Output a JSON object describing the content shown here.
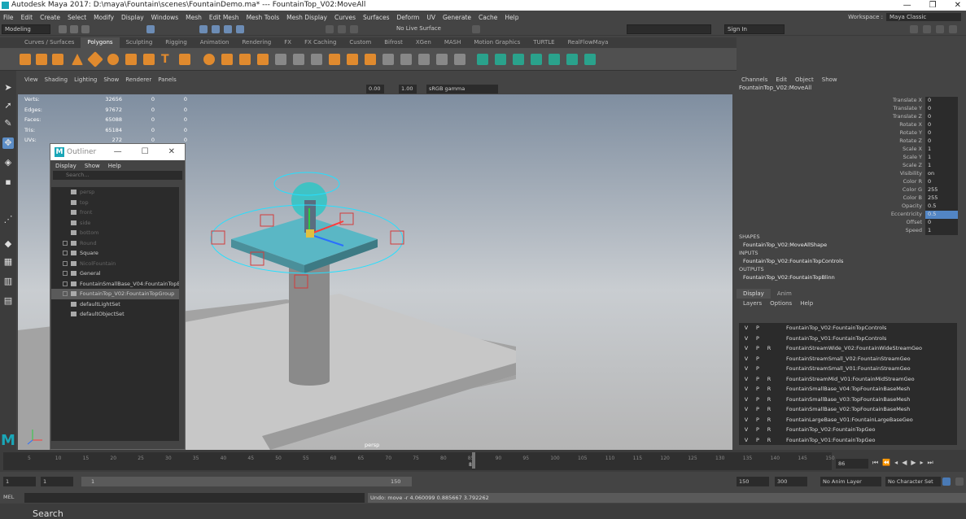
{
  "window": {
    "title": "Autodesk Maya 2017: D:\\maya\\Fountain\\scenes\\FountainDemo.ma*   ---   FountainTop_V02:MoveAll",
    "minimize": "—",
    "maximize": "❐",
    "close": "✕"
  },
  "menubar": [
    "File",
    "Edit",
    "Create",
    "Select",
    "Modify",
    "Display",
    "Windows",
    "Mesh",
    "Edit Mesh",
    "Mesh Tools",
    "Mesh Display",
    "Curves",
    "Surfaces",
    "Deform",
    "UV",
    "Generate",
    "Cache",
    "Help"
  ],
  "workspace": {
    "label": "Workspace :",
    "value": "Maya Classic"
  },
  "statusline": {
    "mode": "Modeling",
    "live_surface": "No Live Surface",
    "sign_in": "Sign In"
  },
  "shelf_tabs": [
    "Curves / Surfaces",
    "Polygons",
    "Sculpting",
    "Rigging",
    "Animation",
    "Rendering",
    "FX",
    "FX Caching",
    "Custom",
    "Bifrost",
    "XGen",
    "MASH",
    "Motion Graphics",
    "TURTLE",
    "RealFlowMaya"
  ],
  "shelf_active": "Polygons",
  "viewport": {
    "menu": [
      "View",
      "Shading",
      "Lighting",
      "Show",
      "Renderer",
      "Panels"
    ],
    "exposure": "0.00",
    "gamma": "1.00",
    "colorspace": "sRGB gamma",
    "camera_label": "persp",
    "hud": [
      {
        "label": "Verts:",
        "a": "32656",
        "b": "0",
        "c": "0"
      },
      {
        "label": "Edges:",
        "a": "97672",
        "b": "0",
        "c": "0"
      },
      {
        "label": "Faces:",
        "a": "65088",
        "b": "0",
        "c": "0"
      },
      {
        "label": "Tris:",
        "a": "65184",
        "b": "0",
        "c": "0"
      },
      {
        "label": "UVs:",
        "a": "272",
        "b": "0",
        "c": "0"
      }
    ]
  },
  "outliner": {
    "title": "Outliner",
    "menu": [
      "Display",
      "Show",
      "Help"
    ],
    "search_placeholder": "Search...",
    "items": [
      {
        "label": "persp",
        "dim": true,
        "exp": false
      },
      {
        "label": "top",
        "dim": true,
        "exp": false
      },
      {
        "label": "front",
        "dim": true,
        "exp": false
      },
      {
        "label": "side",
        "dim": true,
        "exp": false
      },
      {
        "label": "bottom",
        "dim": true,
        "exp": false
      },
      {
        "label": "Round",
        "dim": true,
        "exp": true
      },
      {
        "label": "Square",
        "dim": false,
        "exp": true
      },
      {
        "label": "NicolFountain",
        "dim": true,
        "exp": true
      },
      {
        "label": "General",
        "dim": false,
        "exp": true
      },
      {
        "label": "FountainSmallBase_V04:FountainTopB",
        "dim": false,
        "exp": true
      },
      {
        "label": "FountainTop_V02:FountainTopGroup",
        "dim": false,
        "exp": true,
        "selected": true
      },
      {
        "label": "defaultLightSet",
        "dim": false,
        "exp": false
      },
      {
        "label": "defaultObjectSet",
        "dim": false,
        "exp": false
      }
    ]
  },
  "channelbox": {
    "menu": [
      "Channels",
      "Edit",
      "Object",
      "Show"
    ],
    "object": "FountainTop_V02:MoveAll",
    "attributes": [
      {
        "name": "Translate X",
        "value": "0"
      },
      {
        "name": "Translate Y",
        "value": "0"
      },
      {
        "name": "Translate Z",
        "value": "0"
      },
      {
        "name": "Rotate X",
        "value": "0"
      },
      {
        "name": "Rotate Y",
        "value": "0"
      },
      {
        "name": "Rotate Z",
        "value": "0"
      },
      {
        "name": "Scale X",
        "value": "1"
      },
      {
        "name": "Scale Y",
        "value": "1"
      },
      {
        "name": "Scale Z",
        "value": "1"
      },
      {
        "name": "Visibility",
        "value": "on"
      },
      {
        "name": "Color R",
        "value": "0"
      },
      {
        "name": "Color G",
        "value": "255"
      },
      {
        "name": "Color B",
        "value": "255"
      },
      {
        "name": "Opacity",
        "value": "0.5"
      },
      {
        "name": "Eccentricity",
        "value": "0.5"
      },
      {
        "name": "Offset",
        "value": "0"
      },
      {
        "name": "Speed",
        "value": "1"
      }
    ],
    "shapes_header": "SHAPES",
    "shape": "FountainTop_V02:MoveAllShape",
    "inputs_header": "INPUTS",
    "input": "FountainTop_V02:FountainTopControls",
    "outputs_header": "OUTPUTS",
    "output": "FountainTop_V02:FountainTopBlinn"
  },
  "layer_editor": {
    "tabs": [
      "Display",
      "Anim"
    ],
    "menu": [
      "Layers",
      "Options",
      "Help"
    ],
    "layers": [
      {
        "v": "V",
        "p": "P",
        "r": "",
        "name": "FountainTop_V02:FountainTopControls"
      },
      {
        "v": "V",
        "p": "P",
        "r": "",
        "name": "FountainTop_V01:FountainTopControls"
      },
      {
        "v": "V",
        "p": "P",
        "r": "R",
        "name": "FountainStreamWide_V02:FountainWideStreamGeo"
      },
      {
        "v": "V",
        "p": "P",
        "r": "",
        "name": "FountainStreamSmall_V02:FountainStreamGeo"
      },
      {
        "v": "V",
        "p": "P",
        "r": "",
        "name": "FountainStreamSmall_V01:FountainStreamGeo"
      },
      {
        "v": "V",
        "p": "P",
        "r": "R",
        "name": "FountainStreamMid_V01:FountainMidStreamGeo"
      },
      {
        "v": "V",
        "p": "P",
        "r": "R",
        "name": "FountainSmallBase_V04:TopFountainBaseMesh"
      },
      {
        "v": "V",
        "p": "P",
        "r": "R",
        "name": "FountainSmallBase_V03:TopFountainBaseMesh"
      },
      {
        "v": "V",
        "p": "P",
        "r": "R",
        "name": "FountainSmallBase_V02:TopFountainBaseMesh"
      },
      {
        "v": "V",
        "p": "P",
        "r": "R",
        "name": "FountainLargeBase_V01:FountainLargeBaseGeo"
      },
      {
        "v": "V",
        "p": "P",
        "r": "R",
        "name": "FountainTop_V02:FountainTopGeo"
      },
      {
        "v": "V",
        "p": "P",
        "r": "R",
        "name": "FountainTop_V01:FountainTopGeo"
      }
    ]
  },
  "timeline": {
    "ticks": [
      "5",
      "10",
      "15",
      "20",
      "25",
      "30",
      "35",
      "40",
      "45",
      "50",
      "55",
      "60",
      "65",
      "70",
      "75",
      "80",
      "85",
      "90",
      "95",
      "100",
      "105",
      "110",
      "115",
      "120",
      "125",
      "130",
      "135",
      "140",
      "145",
      "150"
    ],
    "playhead_frame": "86",
    "current_frame": "86"
  },
  "range": {
    "start": "1",
    "start2": "1",
    "range_start_label": "1",
    "range_end_label": "150",
    "end": "150",
    "end2": "300",
    "anim_layer": "No Anim Layer",
    "char_set": "No Character Set"
  },
  "cmdline": {
    "label": "MEL",
    "result": "Undo: move -r 4.060099 0.885667 3.792262"
  },
  "helpline": {
    "text": "Search"
  }
}
